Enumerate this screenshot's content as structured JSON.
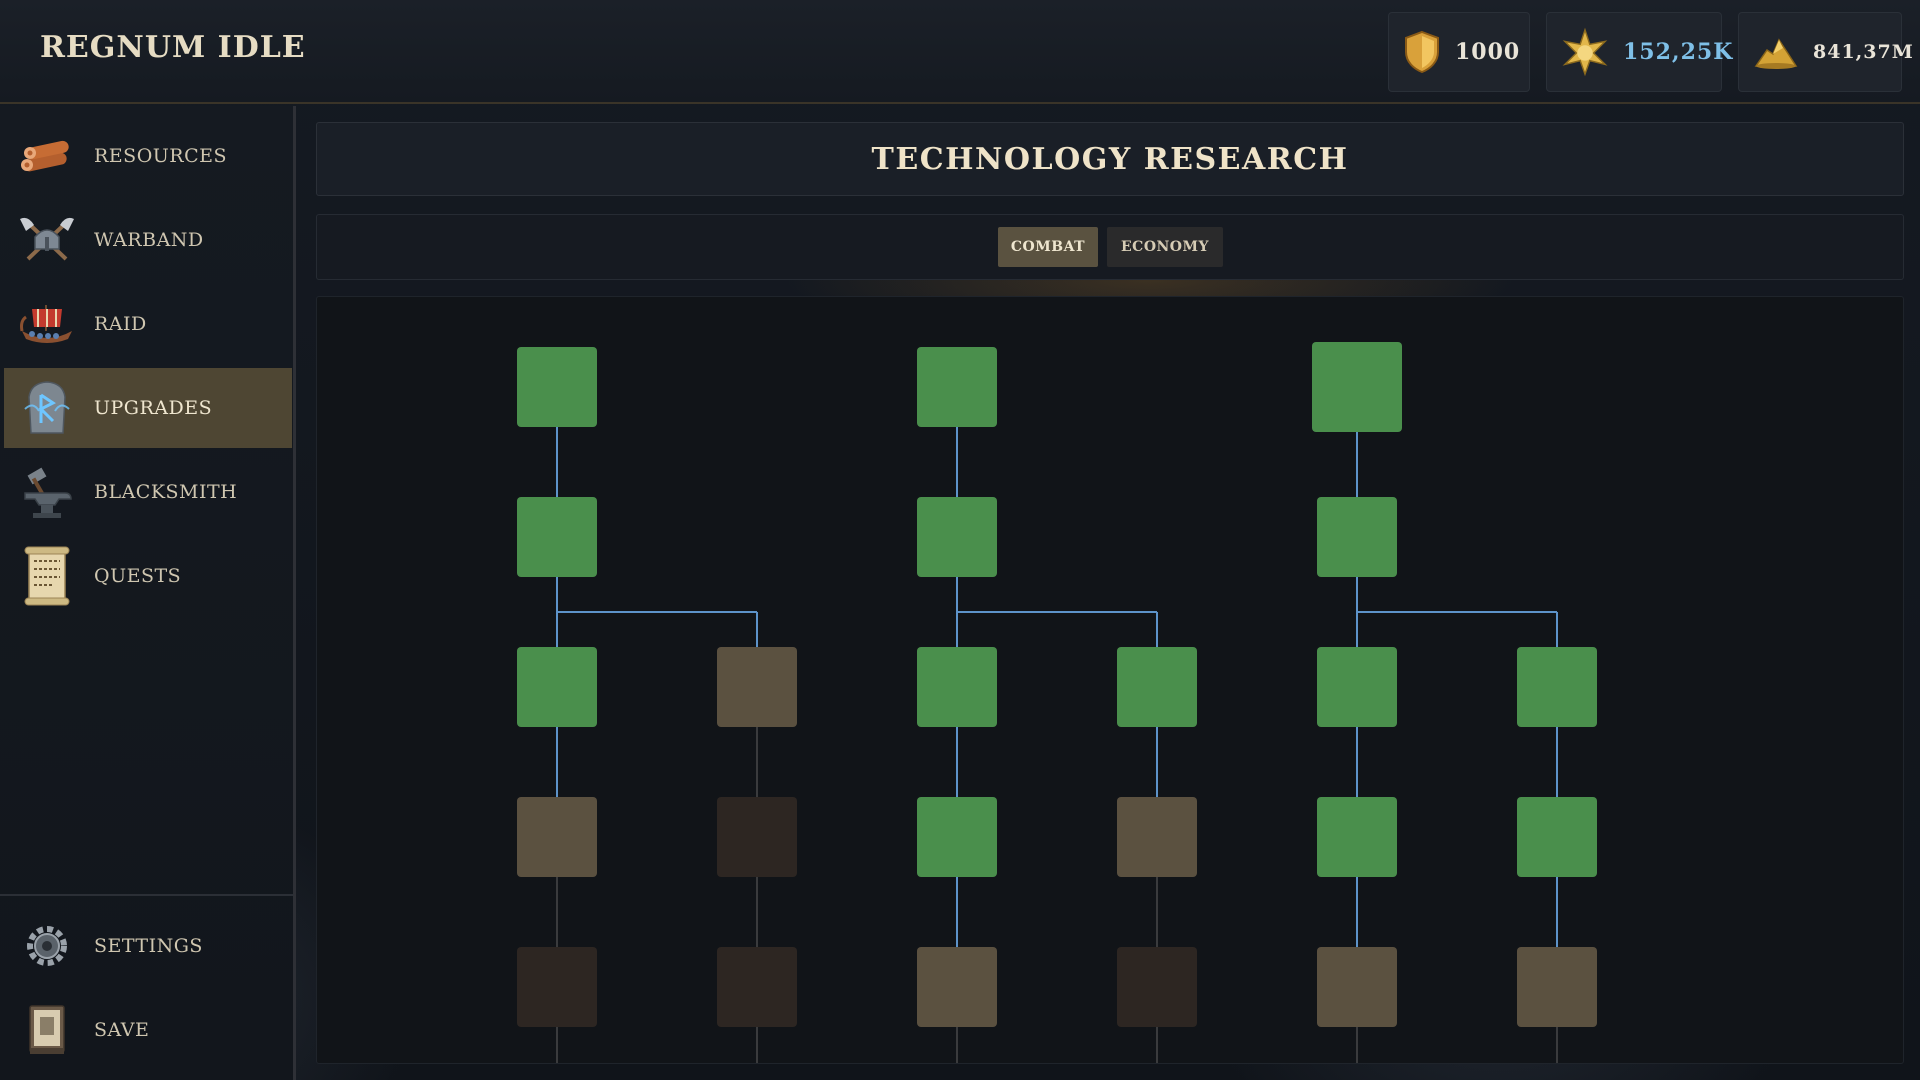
{
  "app": {
    "title": "REGNUM IDLE"
  },
  "resources": {
    "shield": {
      "icon": "shield-icon",
      "value": "1000"
    },
    "renown": {
      "icon": "star-burst-icon",
      "value": "152,25K"
    },
    "gold": {
      "icon": "gold-pile-icon",
      "value": "841,37M"
    }
  },
  "sidebar": {
    "items": [
      {
        "label": "RESOURCES",
        "icon": "logs-icon"
      },
      {
        "label": "WARBAND",
        "icon": "crossed-axes-helmet-icon"
      },
      {
        "label": "RAID",
        "icon": "longship-icon"
      },
      {
        "label": "UPGRADES",
        "icon": "rune-stone-icon",
        "active": true
      },
      {
        "label": "BLACKSMITH",
        "icon": "anvil-hammer-icon"
      },
      {
        "label": "QUESTS",
        "icon": "scroll-icon"
      }
    ],
    "bottom_items": [
      {
        "label": "SETTINGS",
        "icon": "gear-icon"
      },
      {
        "label": "SAVE",
        "icon": "book-icon"
      }
    ]
  },
  "main": {
    "title": "TECHNOLOGY RESEARCH",
    "tabs": [
      {
        "label": "COMBAT",
        "active": true
      },
      {
        "label": "ECONOMY",
        "active": false
      }
    ]
  },
  "tech_tree": {
    "state_colors": {
      "researched": "#4a8f4c",
      "available": "#5b5140",
      "locked": "#2d2622"
    },
    "link_colors": {
      "active": "#5d93c9",
      "inactive": "#3a3b3d"
    },
    "branches": [
      {
        "main_column": [
          "researched",
          "researched",
          "researched",
          "available",
          "locked"
        ],
        "side_column": [
          "available",
          "locked",
          "locked"
        ]
      },
      {
        "main_column": [
          "researched",
          "researched",
          "researched",
          "researched",
          "available"
        ],
        "side_column": [
          "researched",
          "available",
          "locked"
        ]
      },
      {
        "main_column": [
          "researched",
          "researched",
          "researched",
          "researched",
          "available"
        ],
        "side_column": [
          "researched",
          "researched",
          "available"
        ]
      }
    ]
  }
}
